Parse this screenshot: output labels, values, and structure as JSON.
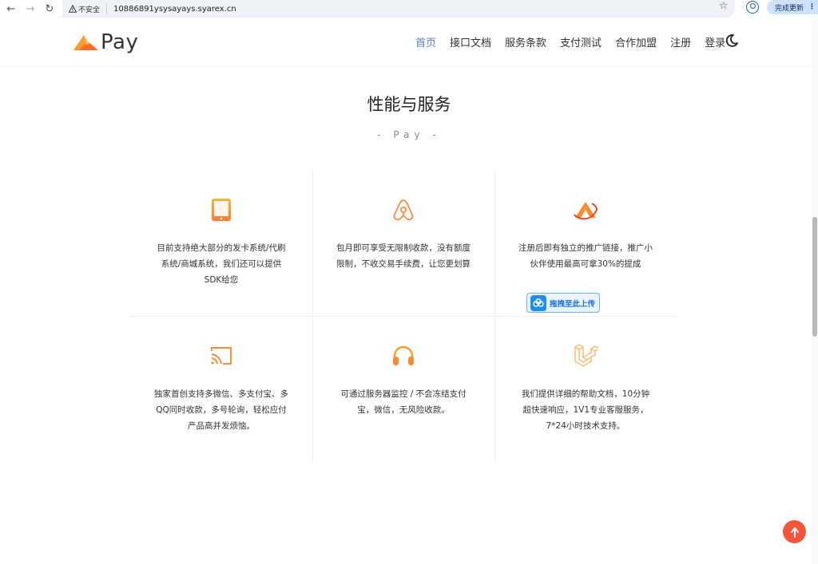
{
  "browser": {
    "back": "←",
    "forward": "→",
    "reload": "↻",
    "security_label": "不安全",
    "url": "10886891ysysayays.syarex.cn",
    "update_label": "完成更新"
  },
  "header": {
    "logo_text": "Pay",
    "menu": [
      {
        "label": "首页",
        "active": true
      },
      {
        "label": "接口文档"
      },
      {
        "label": "服务条款"
      },
      {
        "label": "支付测试"
      },
      {
        "label": "合作加盟"
      },
      {
        "label": "注册"
      },
      {
        "label": "登录"
      }
    ]
  },
  "section": {
    "title": "性能与服务",
    "subtitle": "- Pay -"
  },
  "features": [
    {
      "icon": "tablet-icon",
      "text": "目前支持绝大部分的发卡系统/代刷系统/商城系统，我们还可以提供SDK给您"
    },
    {
      "icon": "airbnb-icon",
      "text": "包月即可享受无限制收款，没有额度限制，不收交易手续费，让您更划算"
    },
    {
      "icon": "affiliate-logo-icon",
      "text": "注册后即有独立的推广链接，推广小伙伴使用最高可拿30%的提成"
    },
    {
      "icon": "cast-icon",
      "text": "独家首创支持多微信、多支付宝、多QQ同时收款，多号轮询，轻松应付产品高并发烦恼。"
    },
    {
      "icon": "headphones-icon",
      "text": "可通过服务器监控 / 不会冻结支付宝，微信，无风险收款。"
    },
    {
      "icon": "laravel-icon",
      "text": "我们提供详细的帮助文档，10分钟超快速响应，1V1专业客服服务，7*24小时技术支持。"
    }
  ],
  "upload_widget": {
    "label": "拖拽至此上传"
  },
  "colors": {
    "accent": "#ff8a3d",
    "active_menu": "#5b7bd5",
    "back_to_top": "#f4553a"
  }
}
